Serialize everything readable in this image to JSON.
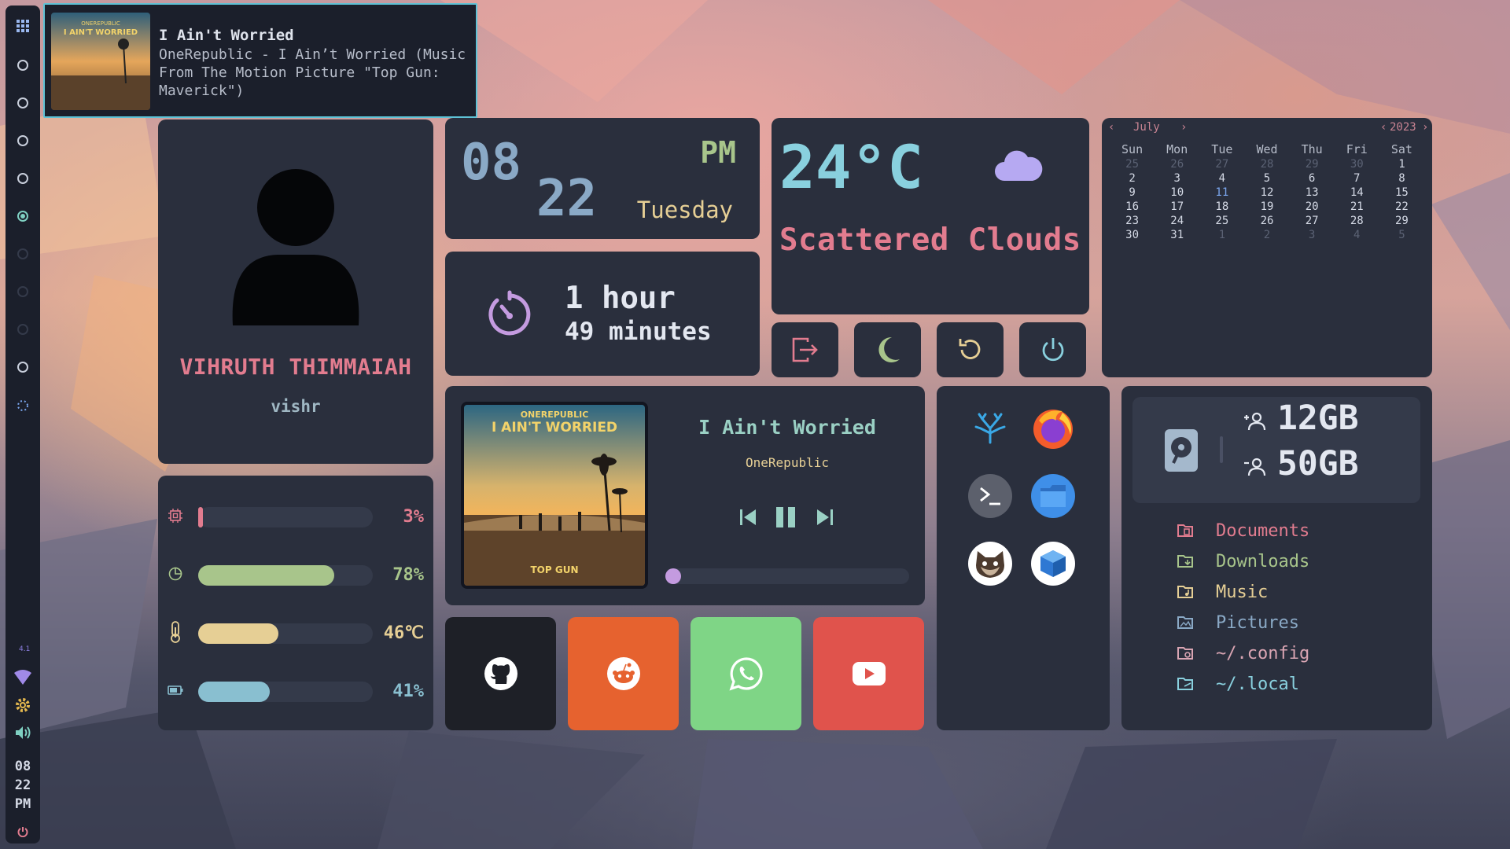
{
  "colors": {
    "accent_pink": "#e27c8f",
    "accent_blue": "#8aa9c6",
    "accent_green": "#a8c58b",
    "accent_yellow": "#e6cf95",
    "accent_cyan": "#89d0de",
    "panel_bg": "#2a2f3d"
  },
  "sidebar": {
    "launcher_icon": "grid-icon",
    "workspaces": [
      {
        "state": "occupied"
      },
      {
        "state": "occupied"
      },
      {
        "state": "occupied"
      },
      {
        "state": "occupied"
      },
      {
        "state": "active"
      },
      {
        "state": "empty"
      },
      {
        "state": "empty"
      },
      {
        "state": "empty"
      },
      {
        "state": "occupied"
      }
    ],
    "clock": {
      "hour": "08",
      "minute": "22",
      "ampm": "PM"
    },
    "tray_icons": [
      "night-light-icon",
      "wifi-icon",
      "settings-gear-icon",
      "volume-icon",
      "power-icon"
    ]
  },
  "notification": {
    "title": "I Ain't Worried",
    "body": "OneRepublic - I Ain’t Worried (Music From The Motion Picture \"Top Gun: Maverick\")"
  },
  "profile": {
    "name": "VIHRUTH THIMMAIAH",
    "username": "vishr"
  },
  "stats": [
    {
      "icon": "cpu-icon",
      "value": 3,
      "label": "3%",
      "color": "#e27c8f"
    },
    {
      "icon": "memory-pie-icon",
      "value": 78,
      "label": "78%",
      "color": "#a8c58b"
    },
    {
      "icon": "thermometer-icon",
      "value": 46,
      "label": "46℃",
      "color": "#e6cf95"
    },
    {
      "icon": "battery-icon",
      "value": 41,
      "label": "41%",
      "color": "#89bfd0"
    }
  ],
  "clock": {
    "hour": "08",
    "minute": "22",
    "ampm": "PM",
    "day": "Tuesday"
  },
  "uptime": {
    "hours": "1 hour",
    "minutes": "49 minutes"
  },
  "weather": {
    "temperature": "24°C",
    "description": "Scattered Clouds",
    "icon": "cloud-icon"
  },
  "power_buttons": [
    "logout-icon",
    "sleep-moon-icon",
    "reboot-icon",
    "shutdown-icon"
  ],
  "calendar": {
    "month": "July",
    "year": "2023",
    "weekdays": [
      "Sun",
      "Mon",
      "Tue",
      "Wed",
      "Thu",
      "Fri",
      "Sat"
    ],
    "weeks": [
      [
        "25",
        "26",
        "27",
        "28",
        "29",
        "30",
        "1"
      ],
      [
        "2",
        "3",
        "4",
        "5",
        "6",
        "7",
        "8"
      ],
      [
        "9",
        "10",
        "11",
        "12",
        "13",
        "14",
        "15"
      ],
      [
        "16",
        "17",
        "18",
        "19",
        "20",
        "21",
        "22"
      ],
      [
        "23",
        "24",
        "25",
        "26",
        "27",
        "28",
        "29"
      ],
      [
        "30",
        "31",
        "1",
        "2",
        "3",
        "4",
        "5"
      ]
    ],
    "today": "11"
  },
  "music": {
    "title": "I Ain't Worried",
    "artist": "OneRepublic",
    "album_art_text_top": "ONEREPUBLIC",
    "album_art_title": "I AIN'T WORRIED",
    "album_art_bottom": "TOP GUN",
    "progress": 0.0,
    "state": "playing"
  },
  "apps": [
    "vscodium-icon",
    "firefox-icon",
    "terminal-icon",
    "files-icon",
    "gimp-icon",
    "virtualbox-icon"
  ],
  "social": [
    {
      "name": "github-icon",
      "color": "#1e2027"
    },
    {
      "name": "reddit-icon",
      "color": "#e6622f"
    },
    {
      "name": "whatsapp-icon",
      "color": "#7fd586"
    },
    {
      "name": "youtube-icon",
      "color": "#e0534c"
    }
  ],
  "storage": {
    "used": "12GB",
    "total": "50GB"
  },
  "folders": [
    {
      "label": "Documents",
      "color": "#e27c8f"
    },
    {
      "label": "Downloads",
      "color": "#a8c58b"
    },
    {
      "label": "Music",
      "color": "#e6cf95"
    },
    {
      "label": "Pictures",
      "color": "#8aa9c6"
    },
    {
      "label": "~/.config",
      "color": "#d9a5b3"
    },
    {
      "label": "~/.local",
      "color": "#89d0de"
    }
  ]
}
